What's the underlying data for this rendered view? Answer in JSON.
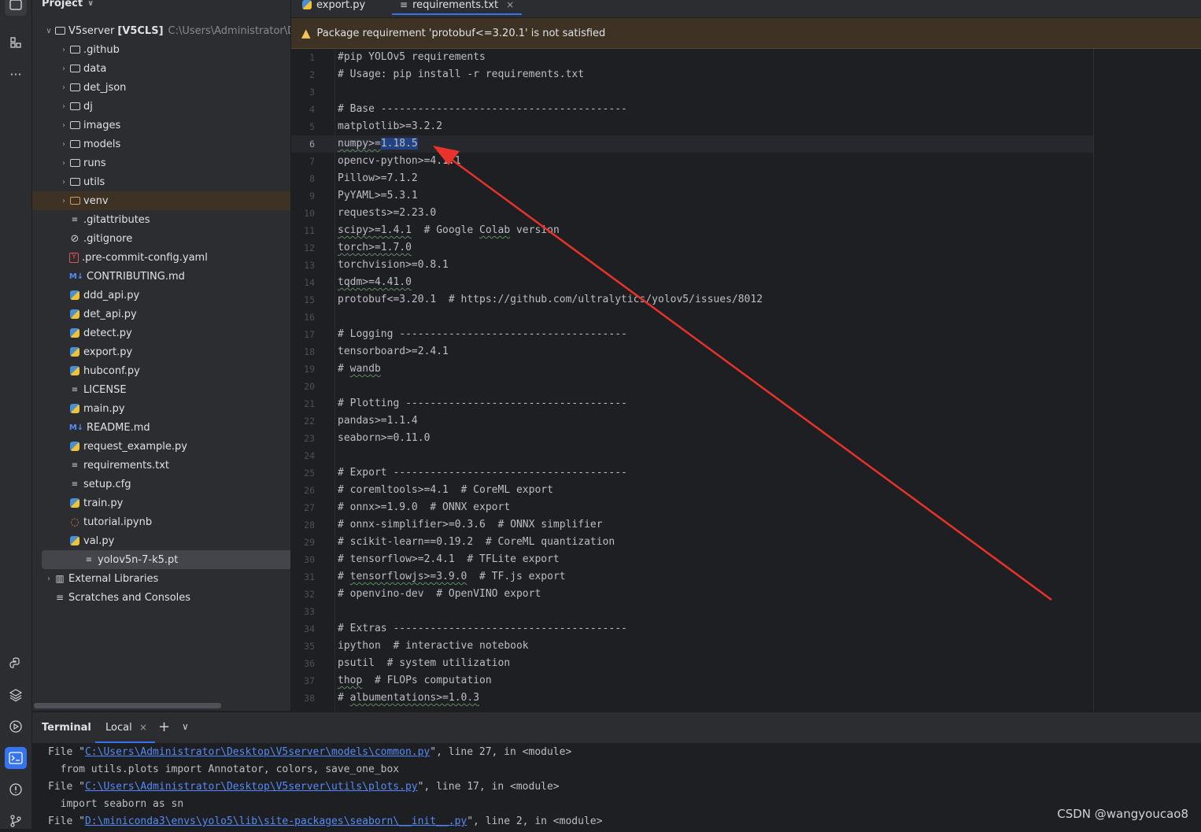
{
  "project": {
    "header": "Project",
    "root_name": "V5server",
    "root_module": "[V5CLS]",
    "root_path": "C:\\Users\\Administrator\\D",
    "items": [
      {
        "label": ".github",
        "kind": "folder"
      },
      {
        "label": "data",
        "kind": "folder"
      },
      {
        "label": "det_json",
        "kind": "folder"
      },
      {
        "label": "dj",
        "kind": "folder"
      },
      {
        "label": "images",
        "kind": "folder"
      },
      {
        "label": "models",
        "kind": "folder"
      },
      {
        "label": "runs",
        "kind": "folder"
      },
      {
        "label": "utils",
        "kind": "folder"
      },
      {
        "label": "venv",
        "kind": "folder-excluded"
      },
      {
        "label": ".gitattributes",
        "kind": "text"
      },
      {
        "label": ".gitignore",
        "kind": "ignore"
      },
      {
        "label": ".pre-commit-config.yaml",
        "kind": "yaml"
      },
      {
        "label": "CONTRIBUTING.md",
        "kind": "markdown"
      },
      {
        "label": "ddd_api.py",
        "kind": "python"
      },
      {
        "label": "det_api.py",
        "kind": "python"
      },
      {
        "label": "detect.py",
        "kind": "python"
      },
      {
        "label": "export.py",
        "kind": "python"
      },
      {
        "label": "hubconf.py",
        "kind": "python"
      },
      {
        "label": "LICENSE",
        "kind": "text"
      },
      {
        "label": "main.py",
        "kind": "python"
      },
      {
        "label": "README.md",
        "kind": "markdown"
      },
      {
        "label": "request_example.py",
        "kind": "python"
      },
      {
        "label": "requirements.txt",
        "kind": "text"
      },
      {
        "label": "setup.cfg",
        "kind": "text"
      },
      {
        "label": "train.py",
        "kind": "python"
      },
      {
        "label": "tutorial.ipynb",
        "kind": "notebook"
      },
      {
        "label": "val.py",
        "kind": "python"
      },
      {
        "label": "yolov5n-7-k5.pt",
        "kind": "text"
      }
    ],
    "external_libraries": "External Libraries",
    "scratches": "Scratches and Consoles"
  },
  "tabs": [
    {
      "label": "export.py"
    },
    {
      "label": "requirements.txt",
      "active": true
    }
  ],
  "banner": {
    "message": "Package requirement 'protobuf<=3.20.1' is not satisfied"
  },
  "editor": {
    "current_line": 6,
    "lines": [
      "#pip YOLOv5 requirements",
      "# Usage: pip install -r requirements.txt",
      "",
      "# Base ----------------------------------------",
      "matplotlib>=3.2.2",
      "numpy>=1.18.5",
      "opencv-python>=4.1.1",
      "Pillow>=7.1.2",
      "PyYAML>=5.3.1",
      "requests>=2.23.0",
      "scipy>=1.4.1  # Google Colab version",
      "torch>=1.7.0",
      "torchvision>=0.8.1",
      "tqdm>=4.41.0",
      "protobuf<=3.20.1  # https://github.com/ultralytics/yolov5/issues/8012",
      "",
      "# Logging -------------------------------------",
      "tensorboard>=2.4.1",
      "# wandb",
      "",
      "# Plotting ------------------------------------",
      "pandas>=1.1.4",
      "seaborn>=0.11.0",
      "",
      "# Export --------------------------------------",
      "# coremltools>=4.1  # CoreML export",
      "# onnx>=1.9.0  # ONNX export",
      "# onnx-simplifier>=0.3.6  # ONNX simplifier",
      "# scikit-learn==0.19.2  # CoreML quantization",
      "# tensorflow>=2.4.1  # TFLite export",
      "# tensorflowjs>=3.9.0  # TF.js export",
      "# openvino-dev  # OpenVINO export",
      "",
      "# Extras --------------------------------------",
      "ipython  # interactive notebook",
      "psutil  # system utilization",
      "thop  # FLOPs computation",
      "# albumentations>=1.0.3"
    ]
  },
  "terminal": {
    "title": "Terminal",
    "tab_label": "Local",
    "lines": [
      {
        "pre": "File \"",
        "link": "C:\\Users\\Administrator\\Desktop\\V5server\\models\\common.py",
        "post": "\", line 27, in <module>"
      },
      {
        "pre": "  from utils.plots import Annotator, colors, save_one_box",
        "link": "",
        "post": ""
      },
      {
        "pre": "File \"",
        "link": "C:\\Users\\Administrator\\Desktop\\V5server\\utils\\plots.py",
        "post": "\", line 17, in <module>"
      },
      {
        "pre": "  import seaborn as sn",
        "link": "",
        "post": ""
      },
      {
        "pre": "File \"",
        "link": "D:\\miniconda3\\envs\\yolo5\\lib\\site-packages\\seaborn\\__init__.py",
        "post": "\", line 2, in <module>"
      }
    ]
  },
  "watermark": "CSDN @wangyoucao8",
  "colors": {
    "accent": "#3574f0",
    "annotation_arrow": "#e8322a",
    "warning": "#f2c55c"
  }
}
